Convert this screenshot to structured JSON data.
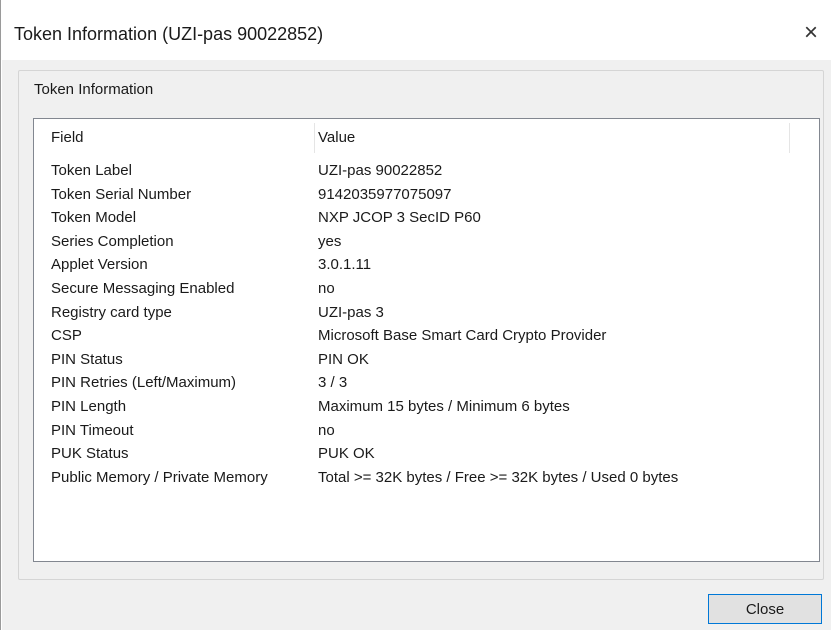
{
  "window": {
    "title": "Token Information (UZI-pas 90022852)",
    "close_glyph": "×"
  },
  "group": {
    "legend": "Token Information"
  },
  "table": {
    "headers": {
      "field": "Field",
      "value": "Value"
    },
    "rows": [
      {
        "field": "Token Label",
        "value": "UZI-pas 90022852"
      },
      {
        "field": "Token Serial Number",
        "value": "9142035977075097"
      },
      {
        "field": "Token Model",
        "value": "NXP JCOP 3 SecID P60"
      },
      {
        "field": "Series Completion",
        "value": "yes"
      },
      {
        "field": "Applet Version",
        "value": "3.0.1.11"
      },
      {
        "field": "Secure Messaging Enabled",
        "value": "no"
      },
      {
        "field": "Registry card type",
        "value": "UZI-pas 3"
      },
      {
        "field": "CSP",
        "value": "Microsoft Base Smart Card Crypto Provider"
      },
      {
        "field": "PIN Status",
        "value": "PIN OK"
      },
      {
        "field": "PIN Retries (Left/Maximum)",
        "value": "3 / 3"
      },
      {
        "field": "PIN Length",
        "value": "Maximum 15 bytes / Minimum 6 bytes"
      },
      {
        "field": "PIN Timeout",
        "value": "no"
      },
      {
        "field": "PUK Status",
        "value": "PUK OK"
      },
      {
        "field": "Public Memory / Private Memory",
        "value": "Total >= 32K bytes / Free >= 32K bytes / Used 0 bytes"
      }
    ]
  },
  "buttons": {
    "close_label": "Close"
  },
  "colors": {
    "accent_border": "#0078d7",
    "client_background": "#f0f0f0",
    "list_background": "#ffffff"
  }
}
